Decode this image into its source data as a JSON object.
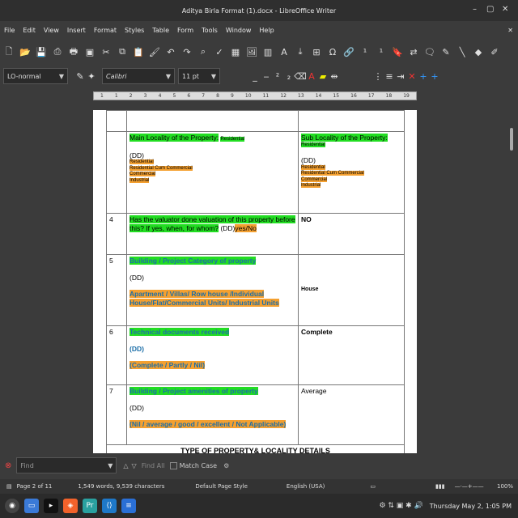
{
  "window": {
    "title": "Aditya Birla Format (1).docx - LibreOffice Writer"
  },
  "menu": [
    "File",
    "Edit",
    "View",
    "Insert",
    "Format",
    "Styles",
    "Table",
    "Form",
    "Tools",
    "Window",
    "Help"
  ],
  "formatting": {
    "paragraph_style": "LO-normal",
    "font_name": "Calibri",
    "font_size": "11 pt"
  },
  "ruler": [
    "1",
    "1",
    "2",
    "3",
    "4",
    "5",
    "6",
    "7",
    "8",
    "9",
    "10",
    "11",
    "12",
    "13",
    "14",
    "15",
    "16",
    "17",
    "18",
    "19"
  ],
  "table": {
    "row_locality": {
      "left_label": "Main Locality of the Property:",
      "left_value": "Residential",
      "left_dd": "(DD)",
      "left_options": [
        "Residential",
        "Residential Cum Commercial",
        "Commercial",
        "Industrial"
      ],
      "right_label": "Sub Locality of the Property:",
      "right_value": "Residential",
      "right_dd": "(DD)",
      "right_options": [
        "Residential",
        "Residential Cum Commercial",
        "Commercial",
        "Industrial"
      ]
    },
    "rows": [
      {
        "num": "4",
        "question": "Has the valuator done valuation of this property before this? If yes, when, for whom?",
        "dd": "(DD)",
        "dd_options": "yes/No",
        "answer": "NO"
      },
      {
        "num": "5",
        "question": "Building / Project Category of property",
        "dd": "(DD)",
        "options": "Apartment / Villas/ Row house /Individual House/Flat/Commercial Units/ Industrial Units",
        "answer": "House"
      },
      {
        "num": "6",
        "question": "Technical documents received",
        "dd": "(DD)",
        "options": "(Complete / Partly / Nil)",
        "answer": "Complete"
      },
      {
        "num": "7",
        "question": "Building / Project amenities of property",
        "dd": "(DD)",
        "options": "(Nil / average / good / excellent / Not Applicable)",
        "answer": "Average"
      }
    ],
    "section_heading": "TYPE OF PROPERTY& LOCALITY DETAILS"
  },
  "findbar": {
    "placeholder": "Find",
    "find_all": "Find All",
    "match_case": "Match Case"
  },
  "status": {
    "page": "Page 2 of 11",
    "words": "1,549 words, 9,539 characters",
    "page_style": "Default Page Style",
    "language": "English (USA)",
    "zoom": "100%"
  },
  "taskbar": {
    "clock": "Thursday May 2, 1:05 PM"
  }
}
